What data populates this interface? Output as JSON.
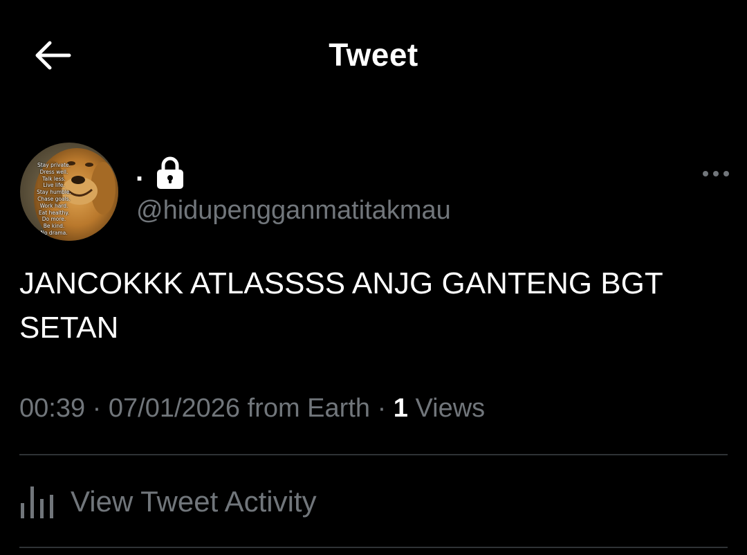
{
  "header": {
    "title": "Tweet",
    "back_icon": "arrow-left-icon"
  },
  "author": {
    "display_name": ".",
    "handle": "@hidupengganmatitakmau",
    "protected_icon": "lock-icon",
    "avatar_lines": [
      "Stay private.",
      "Dress well.",
      "Talk less.",
      "Live life.",
      "Stay humble.",
      "Chase goals.",
      "Work hard.",
      "Eat healthy.",
      "Do more.",
      "Be kind.",
      "No drama."
    ]
  },
  "tweet": {
    "text": "JANCOKKK ATLASSSS ANJG GANTENG BGT SETAN"
  },
  "meta": {
    "time": "00:39",
    "date": "07/01/2026",
    "source": "from Earth",
    "separator": "·",
    "views_count": "1",
    "views_label": "Views"
  },
  "activity": {
    "label": "View Tweet Activity",
    "icon": "bar-chart-icon"
  },
  "colors": {
    "background": "#000000",
    "primary_text": "#ffffff",
    "secondary_text": "#71767b",
    "divider": "#2f3336"
  }
}
